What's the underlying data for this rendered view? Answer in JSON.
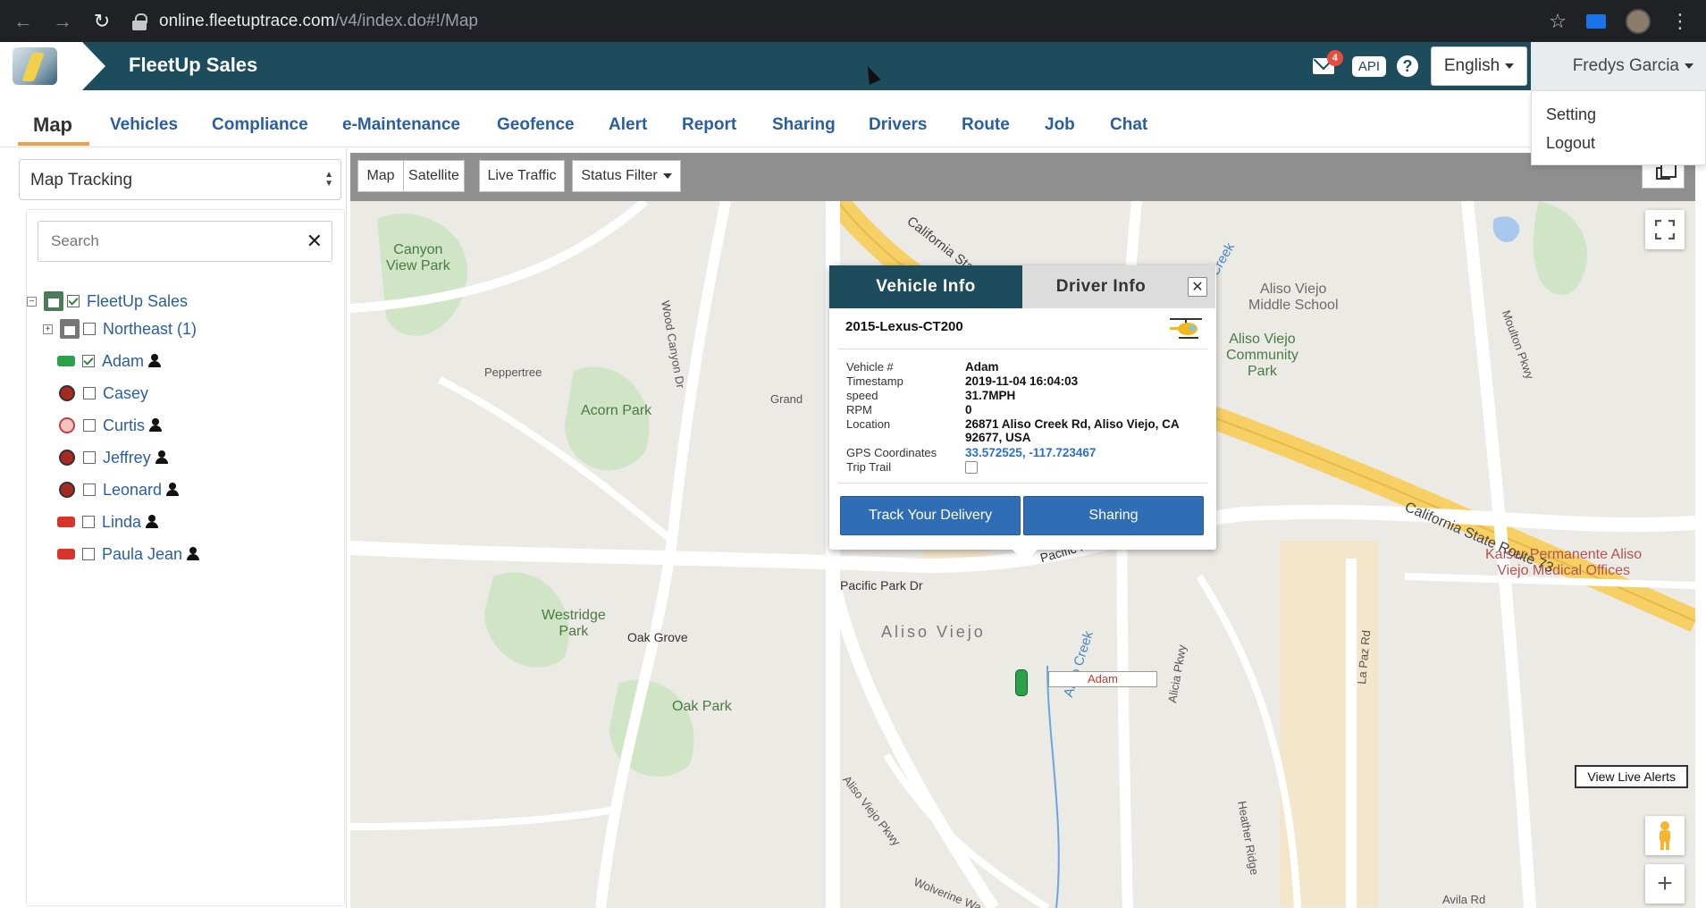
{
  "browser": {
    "url_host": "online.fleetuptrace.com",
    "url_path": "/v4/index.do#!/Map"
  },
  "header": {
    "app_title": "FleetUp Sales",
    "mail_count": "4",
    "api_label": "API",
    "help_label": "?",
    "language": "English",
    "user_name": "Fredys Garcia"
  },
  "user_menu": {
    "items": [
      "Setting",
      "Logout"
    ]
  },
  "nav": {
    "tabs": [
      "Map",
      "Vehicles",
      "Compliance",
      "e-Maintenance",
      "Geofence",
      "Alert",
      "Report",
      "Sharing",
      "Drivers",
      "Route",
      "Job",
      "Chat"
    ],
    "active": "Map"
  },
  "sidebar": {
    "mode_select": "Map Tracking",
    "search_placeholder": "Search",
    "root": "FleetUp Sales",
    "group": "Northeast (1)",
    "vehicles": [
      {
        "name": "Adam",
        "status": "moving",
        "checked": true,
        "driver": true
      },
      {
        "name": "Casey",
        "status": "stopped",
        "checked": false,
        "driver": false
      },
      {
        "name": "Curtis",
        "status": "idle",
        "checked": false,
        "driver": true
      },
      {
        "name": "Jeffrey",
        "status": "stopped",
        "checked": false,
        "driver": true
      },
      {
        "name": "Leonard",
        "status": "stopped",
        "checked": false,
        "driver": true
      },
      {
        "name": "Linda",
        "status": "offline",
        "checked": false,
        "driver": true
      },
      {
        "name": "Paula Jean",
        "status": "offline",
        "checked": false,
        "driver": true
      }
    ]
  },
  "map_toolbar": {
    "map": "Map",
    "satellite": "Satellite",
    "live_traffic": "Live Traffic",
    "status_filter": "Status Filter"
  },
  "map": {
    "view_live_alerts": "View Live Alerts",
    "vehicle_tag": "Adam",
    "labels": {
      "canyon_view_park": "Canyon\nView Park",
      "acorn_park": "Acorn Park",
      "westridge_park": "Westridge\nPark",
      "oak_park": "Oak Park",
      "aliso_viejo": "Aliso Viejo",
      "middle_school": "Aliso Viejo\nMiddle School",
      "community_park": "Aliso Viejo\nCommunity\nPark",
      "kaiser": "Kaiser Permanente Aliso\nViejo Medical Offices",
      "ca_route_73": "California State Route 73",
      "ca_state_r": "California State R",
      "pacific_park_dr": "Pacific Park Dr",
      "pacific_park_dr2": "Pacific Park Dr",
      "aliso_creek": "Aliso Creek",
      "aliso_creek2": "Aliso Creek",
      "wood_canyon_dr": "Wood Canyon Dr",
      "oak_grove": "Oak Grove",
      "aliso_viejo_pkwy": "Aliso Viejo Pkwy",
      "alicia_pkwy": "Alicia Pkwy",
      "la_paz_rd": "La Paz Rd",
      "moulton_pkwy": "Moulton Pkwy",
      "grand": "Grand",
      "peppertree": "Peppertree",
      "heather_ridge": "Heather Ridge",
      "avila_rd": "Avila Rd",
      "wolverine_way": "Wolverine Wa",
      "route_73_shield": "73"
    }
  },
  "popup": {
    "tab_vehicle": "Vehicle Info",
    "tab_driver": "Driver Info",
    "vehicle_name": "2015-Lexus-CT200",
    "fields": [
      {
        "label": "Vehicle #",
        "value": "Adam"
      },
      {
        "label": "Timestamp",
        "value": "2019-11-04 16:04:03"
      },
      {
        "label": "speed",
        "value": "31.7MPH"
      },
      {
        "label": "RPM",
        "value": "0"
      },
      {
        "label": "Location",
        "value": "26871 Aliso Creek Rd, Aliso Viejo, CA 92677, USA"
      },
      {
        "label": "GPS Coordinates",
        "value": "33.572525, -117.723467"
      },
      {
        "label": "Trip Trail",
        "value": ""
      }
    ],
    "btn_track": "Track Your Delivery",
    "btn_sharing": "Sharing"
  }
}
